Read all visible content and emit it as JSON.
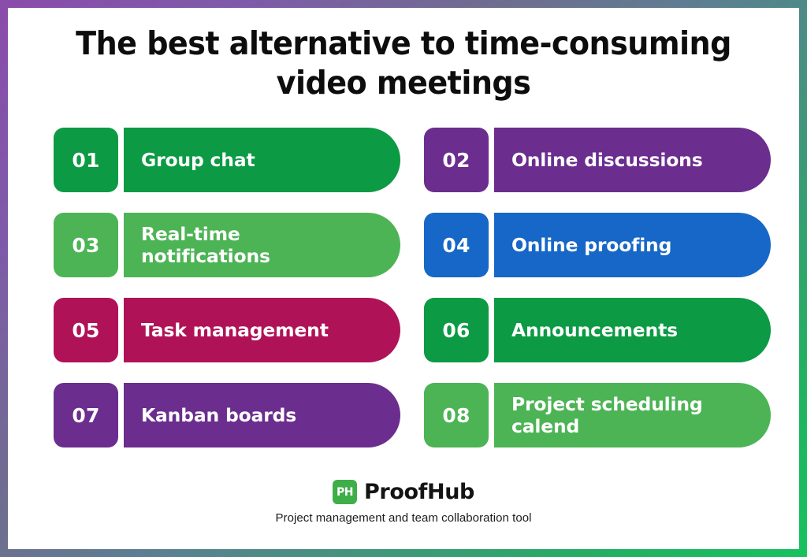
{
  "title": {
    "line1": "The best alternative to time-consuming",
    "line2": "video meetings"
  },
  "border": {
    "gradient_start": "#8B4BAB",
    "gradient_mid": "#5C7F92",
    "gradient_end": "#17C25E"
  },
  "items": [
    {
      "number": "01",
      "label_line1": "Group chat",
      "label_line2": "",
      "color": "#0C9A44"
    },
    {
      "number": "02",
      "label_line1": "Online discussions",
      "label_line2": "",
      "color": "#6B2D8E"
    },
    {
      "number": "03",
      "label_line1": "Real-time",
      "label_line2": "notifications",
      "color": "#4CB455"
    },
    {
      "number": "04",
      "label_line1": "Online proofing",
      "label_line2": "",
      "color": "#1667C8"
    },
    {
      "number": "05",
      "label_line1": "Task management",
      "label_line2": "",
      "color": "#B01257"
    },
    {
      "number": "06",
      "label_line1": "Announcements",
      "label_line2": "",
      "color": "#0C9A44"
    },
    {
      "number": "07",
      "label_line1": "Kanban boards",
      "label_line2": "",
      "color": "#6B2D8E"
    },
    {
      "number": "08",
      "label_line1": "Project scheduling",
      "label_line2": "calend",
      "color": "#4CB455"
    }
  ],
  "footer": {
    "logo_mark_text": "PH",
    "logo_mark_color": "#3FAE49",
    "brand_name": "ProofHub",
    "tagline": "Project management and team collaboration tool"
  }
}
